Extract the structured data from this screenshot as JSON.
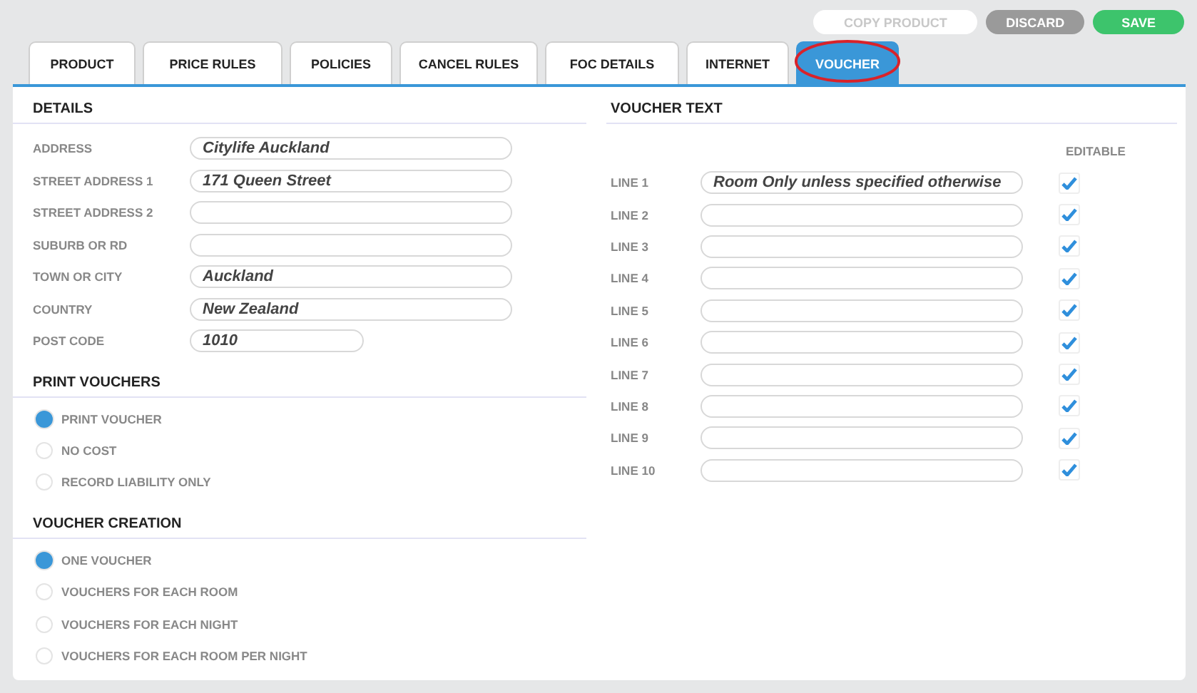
{
  "toolbar": {
    "buttons": [
      {
        "label": "COPY PRODUCT",
        "kind": "ghost"
      },
      {
        "label": "DISCARD",
        "kind": "grey"
      },
      {
        "label": "SAVE",
        "kind": "green"
      }
    ]
  },
  "tabs": [
    {
      "label": "PRODUCT",
      "selected": false
    },
    {
      "label": "PRICE RULES",
      "selected": false
    },
    {
      "label": "POLICIES",
      "selected": false
    },
    {
      "label": "CANCEL RULES",
      "selected": false
    },
    {
      "label": "FOC DETAILS",
      "selected": false
    },
    {
      "label": "INTERNET",
      "selected": false
    },
    {
      "label": "VOUCHER",
      "selected": true,
      "circled": true
    }
  ],
  "details": {
    "title": "DETAILS",
    "fields": [
      {
        "label": "ADDRESS",
        "value": "Citylife Auckland"
      },
      {
        "label": "STREET ADDRESS 1",
        "value": "171 Queen Street"
      },
      {
        "label": "STREET ADDRESS 2"
      },
      {
        "label": "SUBURB OR RD"
      },
      {
        "label": "TOWN OR CITY",
        "value": "Auckland"
      },
      {
        "label": "COUNTRY",
        "value": "New Zealand"
      },
      {
        "label": "POST CODE",
        "value": "1010",
        "kind": "short"
      }
    ]
  },
  "print_vouchers": {
    "title": "PRINT VOUCHERS",
    "options": [
      {
        "label": "PRINT VOUCHER",
        "selected": true
      },
      {
        "label": "NO COST",
        "selected": false
      },
      {
        "label": "RECORD LIABILITY ONLY",
        "selected": false
      }
    ]
  },
  "voucher_creation": {
    "title": "VOUCHER CREATION",
    "options": [
      {
        "label": "ONE VOUCHER",
        "selected": true
      },
      {
        "label": "VOUCHERS FOR EACH ROOM",
        "selected": false
      },
      {
        "label": "VOUCHERS FOR EACH NIGHT",
        "selected": false
      },
      {
        "label": "VOUCHERS FOR EACH ROOM PER NIGHT",
        "selected": false
      }
    ]
  },
  "voucher_text": {
    "title": "VOUCHER TEXT",
    "editable_header": "EDITABLE",
    "lines": [
      {
        "label": "LINE 1",
        "value": "Room Only unless specified otherwise",
        "editable": true
      },
      {
        "label": "LINE 2",
        "editable": true
      },
      {
        "label": "LINE 3",
        "editable": true
      },
      {
        "label": "LINE 4",
        "editable": true
      },
      {
        "label": "LINE 5",
        "editable": true
      },
      {
        "label": "LINE 6",
        "editable": true
      },
      {
        "label": "LINE 7",
        "editable": true
      },
      {
        "label": "LINE 8",
        "editable": true
      },
      {
        "label": "LINE 9",
        "editable": true
      },
      {
        "label": "LINE 10",
        "editable": true
      }
    ]
  }
}
